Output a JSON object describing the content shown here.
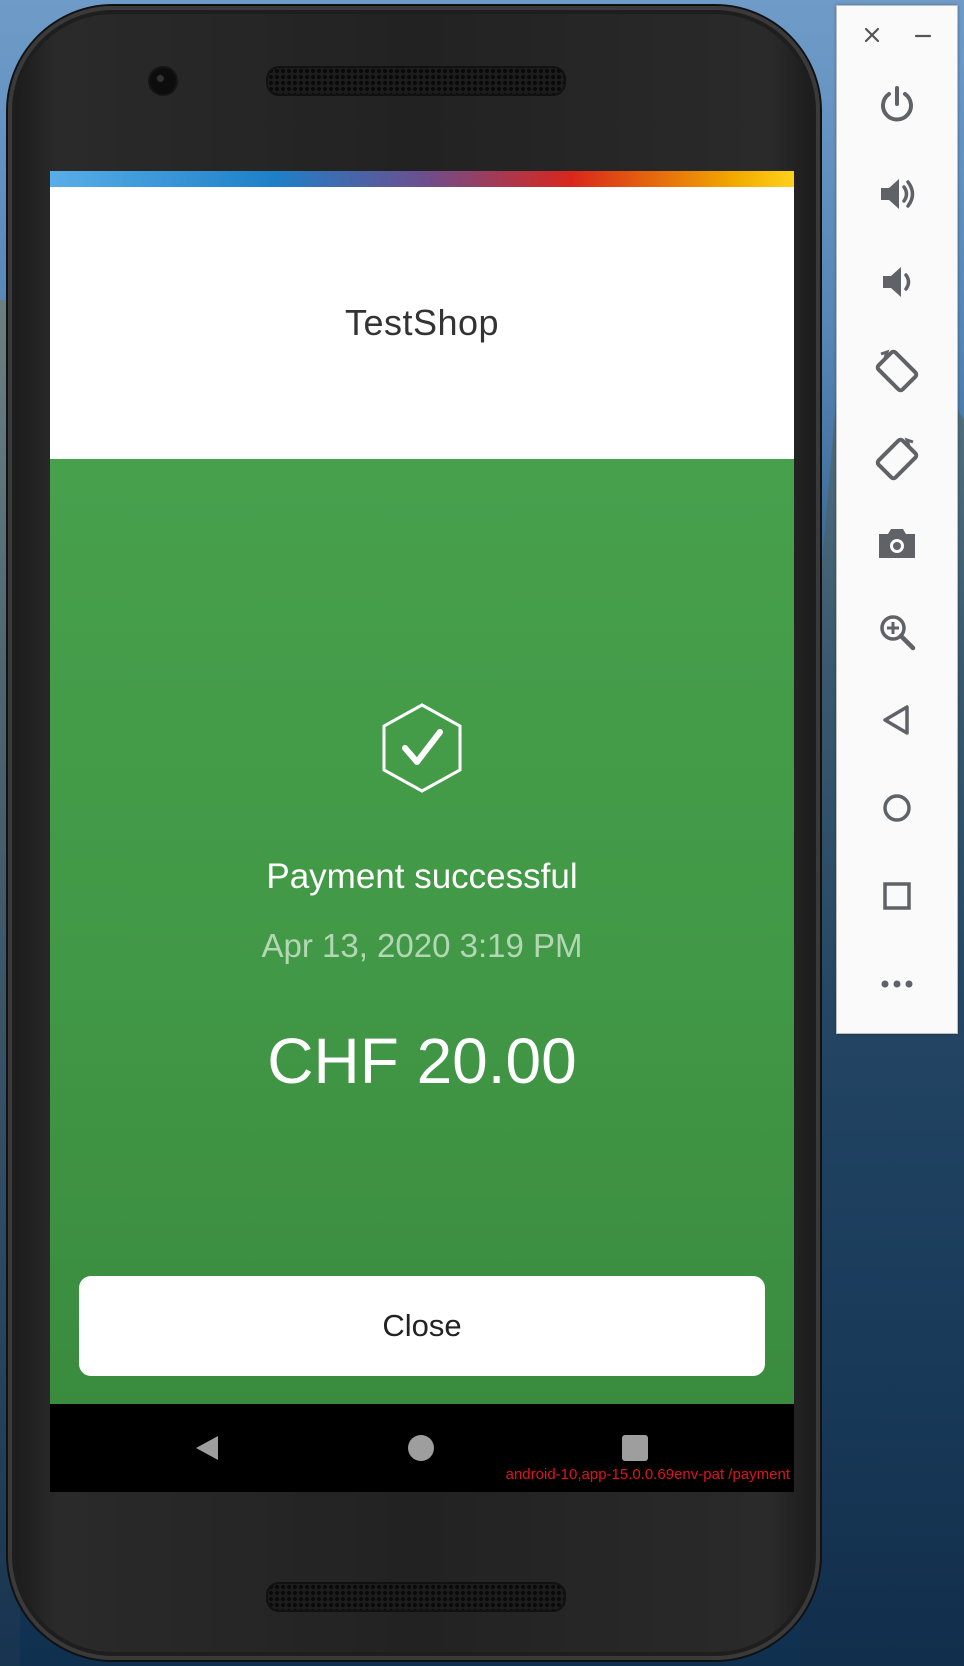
{
  "app": {
    "shop_name": "TestShop",
    "status": "Payment successful",
    "datetime": "Apr 13, 2020 3:19 PM",
    "amount": "CHF 20.00",
    "close_label": "Close"
  },
  "debug": {
    "build_tag": "android-10,app-15.0.0.69env-pat /payment"
  },
  "android_nav": {
    "items": [
      "back-icon",
      "home-icon",
      "recents-icon"
    ]
  },
  "emulator_toolbar": {
    "window_controls": [
      "close-icon",
      "minimize-icon"
    ],
    "buttons": [
      "power-icon",
      "volume-up-icon",
      "volume-down-icon",
      "rotate-left-icon",
      "rotate-right-icon",
      "camera-icon",
      "zoom-icon",
      "back-icon",
      "home-icon",
      "overview-icon",
      "more-icon"
    ]
  },
  "colors": {
    "success_green": "#47a04c",
    "error_red": "#e0141c",
    "accent_blue": "#1e80c8",
    "accent_red": "#d9261c",
    "accent_yellow": "#ffd21a"
  }
}
